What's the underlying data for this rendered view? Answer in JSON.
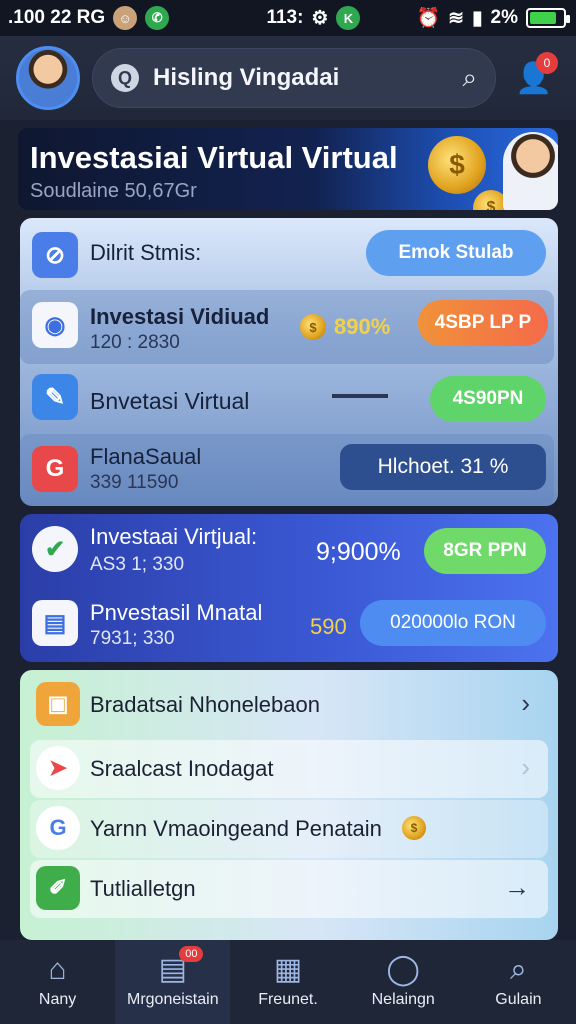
{
  "status_bar": {
    "left_text": ".100 22 RG",
    "time": "113:",
    "battery_text": "2%",
    "battery_level": 0.8,
    "icons": [
      "avatar-icon",
      "whatsapp-icon",
      "settings-icon",
      "app-icon",
      "alarm-icon",
      "wifi-icon",
      "signal-icon"
    ]
  },
  "header": {
    "search_title": "Hisling Vingadai",
    "search_prefix_icon": "Q",
    "notification_count": "0"
  },
  "banner": {
    "title": "Investasiai Virtual Virtual",
    "subtitle": "Soudlaine 50,67Gr"
  },
  "card1": {
    "header": {
      "label": "Dilrit Stmis:",
      "button": "Emok Stulab"
    },
    "rows": [
      {
        "title": "Investasi Vidiuad",
        "sub": "120 : 2830",
        "percent": "890%",
        "button": "4SBP LP P"
      },
      {
        "title": "Bnvetasi Virtual",
        "button": "4S90PN"
      },
      {
        "title": "FlanaSaual",
        "sub": "339 11590",
        "button": "Hlchoet. 31 %"
      }
    ]
  },
  "card2": {
    "rows": [
      {
        "title": "Investaai Virtjual:",
        "sub": "AS3 1; 330",
        "percent": "9;900%",
        "button": "8GR PPN"
      },
      {
        "title": "Pnvestasil Mnatal",
        "sub": "7931; 330",
        "percent": "590",
        "button": "020000lo RON"
      }
    ]
  },
  "list": {
    "items": [
      {
        "label": "Bradatsai Nhonelebaon",
        "chevron": "›"
      },
      {
        "label": "Sraalcast Inodagat",
        "chevron": "›"
      },
      {
        "label": "Yarnn Vmaoingeand Penatain",
        "chevron": ""
      },
      {
        "label": "Tutlialletgn",
        "chevron": "→"
      }
    ]
  },
  "bottom_nav": {
    "items": [
      {
        "label": "Nany",
        "icon": "home-icon"
      },
      {
        "label": "Mrgoneistain",
        "icon": "document-icon",
        "badge": "00"
      },
      {
        "label": "Freunet.",
        "icon": "grid-icon"
      },
      {
        "label": "Nelaingn",
        "icon": "person-icon"
      },
      {
        "label": "Gulain",
        "icon": "search-icon"
      }
    ]
  },
  "colors": {
    "accent_blue": "#3c5ad6",
    "orange_button": "#f07a3a",
    "green_button": "#5fd46a",
    "badge_red": "#e43d3d"
  }
}
